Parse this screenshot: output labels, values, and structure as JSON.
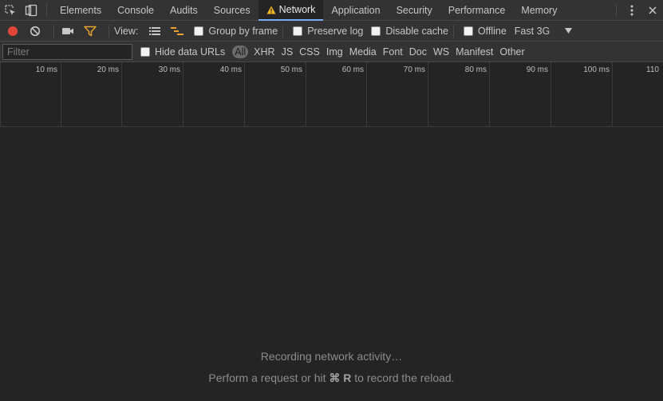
{
  "tabs": [
    {
      "label": "Elements",
      "active": false
    },
    {
      "label": "Console",
      "active": false
    },
    {
      "label": "Audits",
      "active": false
    },
    {
      "label": "Sources",
      "active": false
    },
    {
      "label": "Network",
      "active": true,
      "warning_icon": "warning-icon"
    },
    {
      "label": "Application",
      "active": false
    },
    {
      "label": "Security",
      "active": false
    },
    {
      "label": "Performance",
      "active": false
    },
    {
      "label": "Memory",
      "active": false
    }
  ],
  "toolbar": {
    "view_label": "View:",
    "group_by_frame": {
      "label": "Group by frame",
      "checked": false
    },
    "preserve_log": {
      "label": "Preserve log",
      "checked": false
    },
    "disable_cache": {
      "label": "Disable cache",
      "checked": false
    },
    "offline": {
      "label": "Offline",
      "checked": false
    },
    "throttling": "Fast 3G"
  },
  "filter": {
    "placeholder": "Filter",
    "value": "",
    "hide_data_urls": {
      "label": "Hide data URLs",
      "checked": false
    },
    "types": [
      "All",
      "XHR",
      "JS",
      "CSS",
      "Img",
      "Media",
      "Font",
      "Doc",
      "WS",
      "Manifest",
      "Other"
    ],
    "active_type": "All"
  },
  "overview": {
    "ticks": [
      "10 ms",
      "20 ms",
      "30 ms",
      "40 ms",
      "50 ms",
      "60 ms",
      "70 ms",
      "80 ms",
      "90 ms",
      "100 ms",
      "110"
    ]
  },
  "empty_state": {
    "line1": "Recording network activity…",
    "line2_pre": "Perform a request or hit",
    "line2_key": "⌘ R",
    "line2_post": "to record the reload."
  },
  "colors": {
    "record_red": "#e2453a",
    "filter_orange": "#e6a12f",
    "accent_blue": "#7cacf8",
    "warning_yellow": "#f2b824"
  },
  "icons": {
    "inspect": "inspect-element-icon",
    "device": "device-toolbar-icon",
    "kebab": "more-vertical-icon",
    "close": "close-icon",
    "record": "record-icon",
    "clear": "clear-icon",
    "screenshot": "capture-screenshots-icon",
    "filter": "filter-icon",
    "large_rows": "large-request-rows-icon",
    "overview": "show-overview-icon",
    "dropdown": "dropdown-arrow-icon"
  }
}
